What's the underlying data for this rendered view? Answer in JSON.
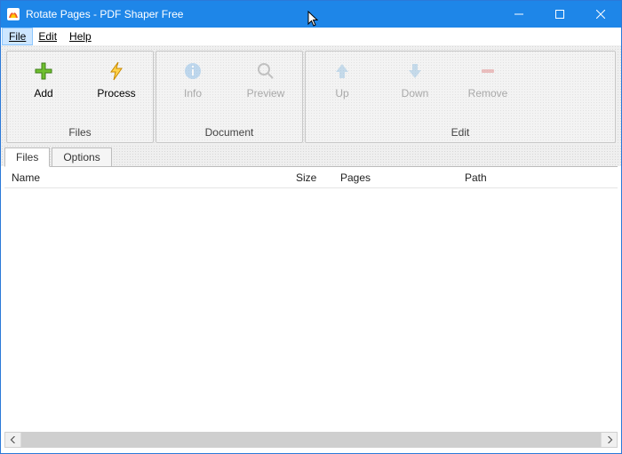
{
  "window": {
    "title": "Rotate Pages - PDF Shaper Free"
  },
  "menubar": {
    "file": "File",
    "edit": "Edit",
    "help": "Help"
  },
  "toolbar": {
    "groups": {
      "files": {
        "label": "Files",
        "add": "Add",
        "process": "Process"
      },
      "document": {
        "label": "Document",
        "info": "Info",
        "preview": "Preview"
      },
      "edit": {
        "label": "Edit",
        "up": "Up",
        "down": "Down",
        "remove": "Remove"
      }
    }
  },
  "tabs": {
    "files": "Files",
    "options": "Options"
  },
  "columns": {
    "name": "Name",
    "size": "Size",
    "pages": "Pages",
    "path": "Path"
  },
  "rows": []
}
